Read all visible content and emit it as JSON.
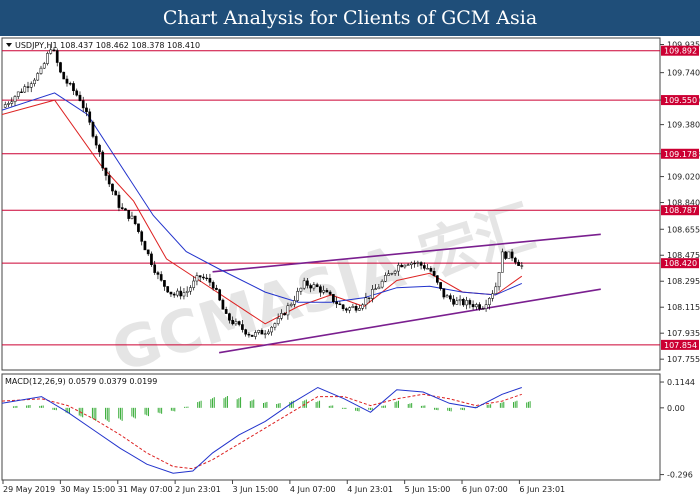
{
  "header": {
    "title": "Chart Analysis for Clients of GCM Asia"
  },
  "chart_data": {
    "type": "candlestick",
    "symbol_info": "USDJPY,H1  108.437 108.462 108.378 108.410",
    "price_axis": {
      "range": [
        107.68,
        109.98
      ],
      "ticks": [
        "109.935",
        "109.740",
        "109.550",
        "109.380",
        "109.178",
        "109.020",
        "108.840",
        "108.655",
        "108.475",
        "108.295",
        "108.115",
        "107.935",
        "107.755"
      ]
    },
    "time_axis": {
      "labels": [
        "29 May 2019",
        "30 May 15:00",
        "31 May 07:00",
        "2 Jun 23:01",
        "3 Jun 15:00",
        "4 Jun 07:00",
        "4 Jun 23:01",
        "5 Jun 15:00",
        "6 Jun 07:00",
        "6 Jun 23:01"
      ]
    },
    "levels": [
      {
        "value": 109.892,
        "label": "109.892",
        "color": "#cc0033"
      },
      {
        "value": 109.55,
        "label": "109.550",
        "color": "#cc0033"
      },
      {
        "value": 109.178,
        "label": "109.178",
        "color": "#cc0033"
      },
      {
        "value": 108.787,
        "label": "108.787",
        "color": "#cc0033"
      },
      {
        "value": 108.42,
        "label": "108.420",
        "color": "#cc0033"
      },
      {
        "value": 107.854,
        "label": "107.854",
        "color": "#cc0033"
      }
    ],
    "channel": {
      "color": "#7a1f8f",
      "upper": [
        [
          0.32,
          108.36
        ],
        [
          0.91,
          108.62
        ]
      ],
      "lower": [
        [
          0.33,
          107.8
        ],
        [
          0.91,
          108.24
        ]
      ]
    },
    "close_path": [
      [
        0.0,
        109.5
      ],
      [
        0.03,
        109.62
      ],
      [
        0.06,
        109.75
      ],
      [
        0.075,
        109.93
      ],
      [
        0.09,
        109.72
      ],
      [
        0.12,
        109.55
      ],
      [
        0.14,
        109.3
      ],
      [
        0.16,
        109.0
      ],
      [
        0.18,
        108.8
      ],
      [
        0.2,
        108.72
      ],
      [
        0.22,
        108.5
      ],
      [
        0.24,
        108.3
      ],
      [
        0.26,
        108.2
      ],
      [
        0.28,
        108.22
      ],
      [
        0.3,
        108.33
      ],
      [
        0.32,
        108.28
      ],
      [
        0.34,
        108.05
      ],
      [
        0.36,
        107.98
      ],
      [
        0.38,
        107.92
      ],
      [
        0.4,
        107.95
      ],
      [
        0.42,
        108.02
      ],
      [
        0.44,
        108.15
      ],
      [
        0.46,
        108.28
      ],
      [
        0.48,
        108.25
      ],
      [
        0.5,
        108.18
      ],
      [
        0.52,
        108.1
      ],
      [
        0.54,
        108.12
      ],
      [
        0.56,
        108.2
      ],
      [
        0.58,
        108.3
      ],
      [
        0.6,
        108.4
      ],
      [
        0.615,
        108.43
      ],
      [
        0.63,
        108.42
      ],
      [
        0.65,
        108.38
      ],
      [
        0.67,
        108.2
      ],
      [
        0.69,
        108.15
      ],
      [
        0.71,
        108.14
      ],
      [
        0.73,
        108.12
      ],
      [
        0.75,
        108.25
      ],
      [
        0.76,
        108.48
      ],
      [
        0.775,
        108.47
      ],
      [
        0.79,
        108.4
      ]
    ],
    "series": [
      {
        "values": [
          [
            0.0,
            109.45
          ],
          [
            0.08,
            109.55
          ],
          [
            0.15,
            109.1
          ],
          [
            0.2,
            108.85
          ],
          [
            0.25,
            108.45
          ],
          [
            0.3,
            108.3
          ],
          [
            0.35,
            108.15
          ],
          [
            0.4,
            108.0
          ],
          [
            0.45,
            108.12
          ],
          [
            0.5,
            108.2
          ],
          [
            0.55,
            108.12
          ],
          [
            0.6,
            108.3
          ],
          [
            0.65,
            108.35
          ],
          [
            0.7,
            108.22
          ],
          [
            0.75,
            108.2
          ],
          [
            0.79,
            108.33
          ]
        ],
        "color": "#dd2222"
      },
      {
        "values": [
          [
            0.0,
            109.48
          ],
          [
            0.08,
            109.6
          ],
          [
            0.13,
            109.45
          ],
          [
            0.18,
            109.1
          ],
          [
            0.23,
            108.75
          ],
          [
            0.28,
            108.5
          ],
          [
            0.33,
            108.38
          ],
          [
            0.4,
            108.22
          ],
          [
            0.45,
            108.15
          ],
          [
            0.5,
            108.15
          ],
          [
            0.55,
            108.18
          ],
          [
            0.6,
            108.25
          ],
          [
            0.65,
            108.26
          ],
          [
            0.7,
            108.22
          ],
          [
            0.75,
            108.2
          ],
          [
            0.79,
            108.28
          ]
        ],
        "color": "#2233cc"
      }
    ],
    "macd": {
      "info": "MACD(12,26,9) 0.0579 0.0379 0.0199",
      "range": [
        -0.32,
        0.15
      ],
      "ticks": [
        "0.1144",
        "0.00",
        "-0.296"
      ],
      "main": [
        [
          0.0,
          0.02
        ],
        [
          0.06,
          0.05
        ],
        [
          0.1,
          -0.02
        ],
        [
          0.14,
          -0.1
        ],
        [
          0.18,
          -0.18
        ],
        [
          0.22,
          -0.25
        ],
        [
          0.26,
          -0.29
        ],
        [
          0.29,
          -0.28
        ],
        [
          0.32,
          -0.2
        ],
        [
          0.36,
          -0.12
        ],
        [
          0.4,
          -0.06
        ],
        [
          0.44,
          0.02
        ],
        [
          0.48,
          0.09
        ],
        [
          0.52,
          0.04
        ],
        [
          0.56,
          -0.02
        ],
        [
          0.6,
          0.08
        ],
        [
          0.64,
          0.07
        ],
        [
          0.68,
          0.02
        ],
        [
          0.72,
          0.0
        ],
        [
          0.76,
          0.06
        ],
        [
          0.79,
          0.09
        ]
      ],
      "signal": [
        [
          0.0,
          0.03
        ],
        [
          0.06,
          0.04
        ],
        [
          0.1,
          0.01
        ],
        [
          0.14,
          -0.05
        ],
        [
          0.18,
          -0.12
        ],
        [
          0.22,
          -0.2
        ],
        [
          0.26,
          -0.26
        ],
        [
          0.29,
          -0.27
        ],
        [
          0.32,
          -0.23
        ],
        [
          0.36,
          -0.16
        ],
        [
          0.4,
          -0.09
        ],
        [
          0.44,
          -0.02
        ],
        [
          0.48,
          0.05
        ],
        [
          0.52,
          0.05
        ],
        [
          0.56,
          0.01
        ],
        [
          0.6,
          0.04
        ],
        [
          0.64,
          0.06
        ],
        [
          0.68,
          0.04
        ],
        [
          0.72,
          0.01
        ],
        [
          0.76,
          0.03
        ],
        [
          0.79,
          0.06
        ]
      ],
      "histogram": [
        [
          0.02,
          0.008
        ],
        [
          0.04,
          0.012
        ],
        [
          0.06,
          0.01
        ],
        [
          0.08,
          -0.01
        ],
        [
          0.1,
          -0.025
        ],
        [
          0.12,
          -0.04
        ],
        [
          0.14,
          -0.055
        ],
        [
          0.16,
          -0.06
        ],
        [
          0.18,
          -0.055
        ],
        [
          0.2,
          -0.045
        ],
        [
          0.22,
          -0.035
        ],
        [
          0.24,
          -0.025
        ],
        [
          0.26,
          -0.015
        ],
        [
          0.28,
          0.005
        ],
        [
          0.3,
          0.03
        ],
        [
          0.32,
          0.045
        ],
        [
          0.34,
          0.05
        ],
        [
          0.36,
          0.045
        ],
        [
          0.38,
          0.035
        ],
        [
          0.4,
          0.025
        ],
        [
          0.42,
          0.02
        ],
        [
          0.44,
          0.03
        ],
        [
          0.46,
          0.035
        ],
        [
          0.48,
          0.03
        ],
        [
          0.5,
          0.01
        ],
        [
          0.52,
          -0.005
        ],
        [
          0.54,
          -0.015
        ],
        [
          0.56,
          -0.01
        ],
        [
          0.58,
          0.01
        ],
        [
          0.6,
          0.03
        ],
        [
          0.62,
          0.02
        ],
        [
          0.64,
          0.01
        ],
        [
          0.66,
          -0.01
        ],
        [
          0.68,
          -0.015
        ],
        [
          0.7,
          -0.01
        ],
        [
          0.72,
          0.005
        ],
        [
          0.74,
          0.015
        ],
        [
          0.76,
          0.025
        ],
        [
          0.78,
          0.03
        ],
        [
          0.8,
          0.028
        ]
      ]
    },
    "watermark": "GCMASIA 宏汇"
  }
}
